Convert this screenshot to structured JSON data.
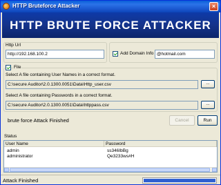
{
  "window": {
    "title": "HTTP Bruteforce Attacker",
    "close_symbol": "×"
  },
  "banner": {
    "text": "HTTP BRUTE FORCE ATTACKER"
  },
  "http_url": {
    "label": "Http Url",
    "value": "http://192.168.100.2"
  },
  "add_domain": {
    "label": "Add Domain Info",
    "checked": true,
    "value": "@hotmail.com"
  },
  "file": {
    "label": "File",
    "checked": true
  },
  "usernames": {
    "label": "Select A file containing User Names in a correct format.",
    "path": "C:\\secure Auditor\\2.0.1300.0051\\Data\\Http_user.csv",
    "browse_label": "..."
  },
  "passwords": {
    "label": "Select A file containing Passwords in a correct format.",
    "path": "C:\\secure Auditor\\2.0.1300.0051\\Data\\httppass.csv",
    "browse_label": "..."
  },
  "attack_status": "brute force Attack Finished",
  "buttons": {
    "cancel": "Cancel",
    "run": "Run"
  },
  "status_section": {
    "label": "Status"
  },
  "results": {
    "columns": [
      "User Name",
      "Password"
    ],
    "rows": [
      [
        "admin",
        "ss346IbBg"
      ],
      [
        "administrator",
        "Qe3233ws#H"
      ]
    ]
  },
  "statusbar": {
    "text": "Attack Finished",
    "progress": 1.0
  },
  "colors": {
    "banner": "#14338a",
    "titlebar": "#1b58d0",
    "progress": "#2f5fd0"
  }
}
